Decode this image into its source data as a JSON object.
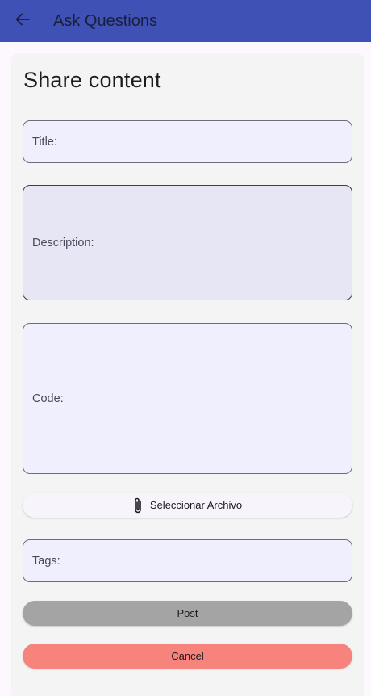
{
  "appbar": {
    "title": "Ask Questions",
    "back_icon": "arrow-back-icon"
  },
  "form": {
    "heading": "Share content",
    "title_label": "Title:",
    "description_label": "Description:",
    "code_label": "Code:",
    "file_button_label": "Seleccionar Archivo",
    "file_icon": "paperclip-icon",
    "tags_label": "Tags:",
    "post_label": "Post",
    "cancel_label": "Cancel"
  },
  "colors": {
    "appbar": "#3f51b5",
    "post_button": "#a4a4a4",
    "cancel_button": "#f7837d",
    "field_background": "#efeffd"
  }
}
